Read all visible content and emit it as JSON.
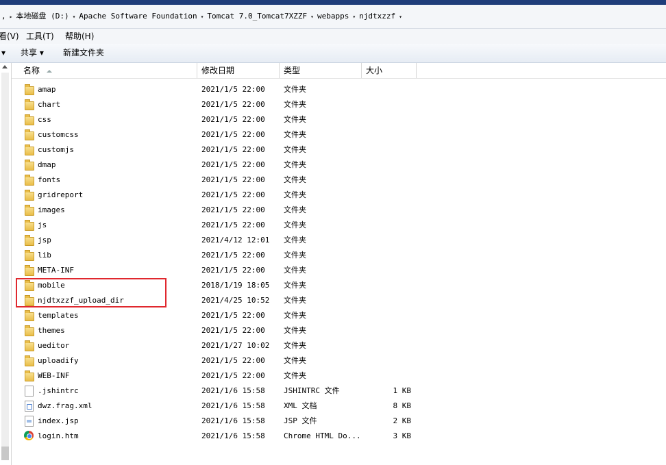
{
  "address_bar": {
    "prefix": ",",
    "crumbs": [
      "本地磁盘 (D:)",
      "Apache Software Foundation",
      "Tomcat 7.0_Tomcat7XZZF",
      "webapps",
      "njdtxzzf"
    ]
  },
  "menu": {
    "view": "看(V)",
    "tools": "工具(T)",
    "help": "帮助(H)"
  },
  "toolbar": {
    "share": "共享",
    "new_folder": "新建文件夹"
  },
  "columns": {
    "name": "名称",
    "date": "修改日期",
    "type": "类型",
    "size": "大小"
  },
  "files": [
    {
      "name": "amap",
      "date": "2021/1/5 22:00",
      "type": "文件夹",
      "size": "",
      "icon": "folder"
    },
    {
      "name": "chart",
      "date": "2021/1/5 22:00",
      "type": "文件夹",
      "size": "",
      "icon": "folder"
    },
    {
      "name": "css",
      "date": "2021/1/5 22:00",
      "type": "文件夹",
      "size": "",
      "icon": "folder"
    },
    {
      "name": "customcss",
      "date": "2021/1/5 22:00",
      "type": "文件夹",
      "size": "",
      "icon": "folder"
    },
    {
      "name": "customjs",
      "date": "2021/1/5 22:00",
      "type": "文件夹",
      "size": "",
      "icon": "folder"
    },
    {
      "name": "dmap",
      "date": "2021/1/5 22:00",
      "type": "文件夹",
      "size": "",
      "icon": "folder"
    },
    {
      "name": "fonts",
      "date": "2021/1/5 22:00",
      "type": "文件夹",
      "size": "",
      "icon": "folder"
    },
    {
      "name": "gridreport",
      "date": "2021/1/5 22:00",
      "type": "文件夹",
      "size": "",
      "icon": "folder"
    },
    {
      "name": "images",
      "date": "2021/1/5 22:00",
      "type": "文件夹",
      "size": "",
      "icon": "folder"
    },
    {
      "name": "js",
      "date": "2021/1/5 22:00",
      "type": "文件夹",
      "size": "",
      "icon": "folder"
    },
    {
      "name": "jsp",
      "date": "2021/4/12 12:01",
      "type": "文件夹",
      "size": "",
      "icon": "folder"
    },
    {
      "name": "lib",
      "date": "2021/1/5 22:00",
      "type": "文件夹",
      "size": "",
      "icon": "folder"
    },
    {
      "name": "META-INF",
      "date": "2021/1/5 22:00",
      "type": "文件夹",
      "size": "",
      "icon": "folder"
    },
    {
      "name": "mobile",
      "date": "2018/1/19 18:05",
      "type": "文件夹",
      "size": "",
      "icon": "folder"
    },
    {
      "name": "njdtxzzf_upload_dir",
      "date": "2021/4/25 10:52",
      "type": "文件夹",
      "size": "",
      "icon": "folder"
    },
    {
      "name": "templates",
      "date": "2021/1/5 22:00",
      "type": "文件夹",
      "size": "",
      "icon": "folder"
    },
    {
      "name": "themes",
      "date": "2021/1/5 22:00",
      "type": "文件夹",
      "size": "",
      "icon": "folder"
    },
    {
      "name": "ueditor",
      "date": "2021/1/27 10:02",
      "type": "文件夹",
      "size": "",
      "icon": "folder"
    },
    {
      "name": "uploadify",
      "date": "2021/1/5 22:00",
      "type": "文件夹",
      "size": "",
      "icon": "folder"
    },
    {
      "name": "WEB-INF",
      "date": "2021/1/5 22:00",
      "type": "文件夹",
      "size": "",
      "icon": "folder"
    },
    {
      "name": ".jshintrc",
      "date": "2021/1/6 15:58",
      "type": "JSHINTRC 文件",
      "size": "1 KB",
      "icon": "file"
    },
    {
      "name": "dwz.frag.xml",
      "date": "2021/1/6 15:58",
      "type": "XML 文档",
      "size": "8 KB",
      "icon": "file-xml"
    },
    {
      "name": "index.jsp",
      "date": "2021/1/6 15:58",
      "type": "JSP 文件",
      "size": "2 KB",
      "icon": "file-jsp"
    },
    {
      "name": "login.htm",
      "date": "2021/1/6 15:58",
      "type": "Chrome HTML Do...",
      "size": "3 KB",
      "icon": "chrome"
    }
  ],
  "highlight_color": "#e0282e"
}
